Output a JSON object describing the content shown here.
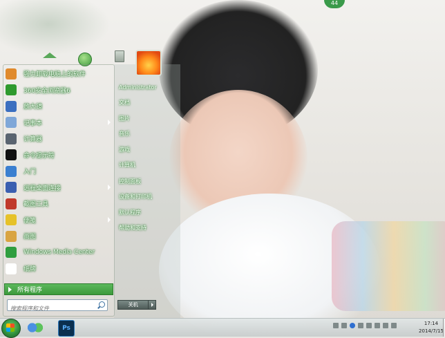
{
  "top_badge": "44",
  "start_menu": {
    "programs": [
      {
        "label": "强力卸载电脑上的软件",
        "icon": "uninstall-icon",
        "color": "#e08a2c",
        "submenu": false
      },
      {
        "label": "360安全浏览器6",
        "icon": "browser-360-icon",
        "color": "#2e9a2e",
        "submenu": false
      },
      {
        "label": "放大镜",
        "icon": "magnifier-icon",
        "color": "#3b6fc0",
        "submenu": false
      },
      {
        "label": "记事本",
        "icon": "notepad-icon",
        "color": "#7fa7d8",
        "submenu": true
      },
      {
        "label": "计算器",
        "icon": "calculator-icon",
        "color": "#5a6470",
        "submenu": false
      },
      {
        "label": "命令提示符",
        "icon": "cmd-icon",
        "color": "#111111",
        "submenu": false
      },
      {
        "label": "入门",
        "icon": "getting-started-icon",
        "color": "#3a7fd0",
        "submenu": false
      },
      {
        "label": "远程桌面连接",
        "icon": "remote-desktop-icon",
        "color": "#3a5fb0",
        "submenu": true
      },
      {
        "label": "截图工具",
        "icon": "snipping-tool-icon",
        "color": "#c0392b",
        "submenu": false
      },
      {
        "label": "便笺",
        "icon": "sticky-notes-icon",
        "color": "#e6c229",
        "submenu": true
      },
      {
        "label": "画图",
        "icon": "paint-icon",
        "color": "#d9a441",
        "submenu": false
      },
      {
        "label": "Windows Media Center",
        "icon": "media-center-icon",
        "color": "#2f9e3f",
        "submenu": false
      },
      {
        "label": "纸牌",
        "icon": "solitaire-icon",
        "color": "#ffffff",
        "submenu": false
      }
    ],
    "all_programs": "所有程序",
    "search_placeholder": "搜索程序和文件",
    "places": [
      {
        "label": "Administrator"
      },
      {
        "label": "文档"
      },
      {
        "label": "图片"
      },
      {
        "label": "音乐"
      },
      {
        "label": "游戏"
      },
      {
        "label": "计算机"
      },
      {
        "label": "控制面板"
      },
      {
        "label": "设备和打印机"
      },
      {
        "label": "默认程序"
      },
      {
        "label": "帮助和支持"
      }
    ],
    "shutdown_label": "关机"
  },
  "taskbar": {
    "clock_time": "17:14",
    "clock_date": "2014/7/15",
    "ps_label": "Ps"
  }
}
